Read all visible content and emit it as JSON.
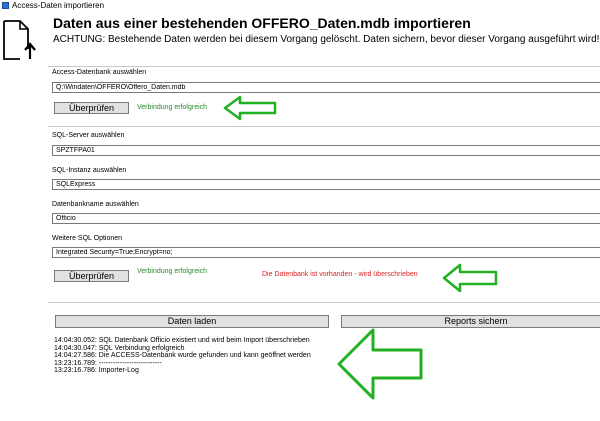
{
  "window": {
    "title": "Access-Daten importieren"
  },
  "header": {
    "title": "Daten aus einer bestehenden OFFERO_Daten.mdb importieren",
    "warning": "ACHTUNG: Bestehende Daten werden bei diesem Vorgang gelöscht. Daten sichern, bevor dieser Vorgang ausgeführt wird!"
  },
  "access": {
    "label": "Access-Datenbank auswählen",
    "path": "Q:\\Windaten\\OFFERO\\Offero_Daten.mdb",
    "check_button": "Überprüfen",
    "status": "Verbindung erfolgreich"
  },
  "sql": {
    "server_label": "SQL-Server auswählen",
    "server_value": "SPZTFPA01",
    "instance_label": "SQL-Instanz auswählen",
    "instance_value": "SQLExpress",
    "dbname_label": "Datenbankname auswählen",
    "dbname_value": "Officio",
    "options_label": "Weitere SQL Optionen",
    "options_value": "Integrated Security=True;Encrypt=no;",
    "check_button": "Überprüfen",
    "status": "Verbindung erfolgreich",
    "warning": "Die Datenbank ist vorhanden - wird überschrieben"
  },
  "actions": {
    "load_button": "Daten laden",
    "backup_button": "Reports sichern"
  },
  "log": [
    "14:04:30.052: SQL Datenbank Officio existiert und wird beim Import überschrieben",
    "14:04:30.047: SQL Verbindung erfolgreich",
    "14:04:27.586: Die ACCESS-Datenbank wurde gefunden und kann geöffnet werden",
    "13:23:16.789: ---------------------------",
    "13:23:16.786: Importer-Log"
  ],
  "colors": {
    "success": "#2a8a2a",
    "error": "#e02020",
    "arrow": "#22b022",
    "button_bg": "#e1e1e1"
  }
}
